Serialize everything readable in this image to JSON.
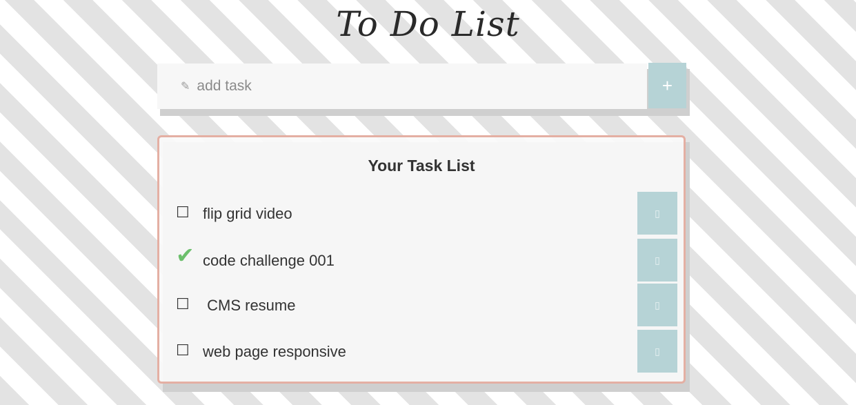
{
  "header": {
    "title": "To Do List"
  },
  "add_form": {
    "icon": "pencil-icon",
    "placeholder": "add task",
    "add_button_label": "+"
  },
  "task_list": {
    "title": "Your Task List",
    "items": [
      {
        "label": "flip grid video",
        "done": false,
        "check_glyph": "☐",
        "delete_glyph": "▯"
      },
      {
        "label": "code challenge 001",
        "done": true,
        "check_glyph": "✔",
        "delete_glyph": "▯"
      },
      {
        "label": " CMS resume",
        "done": false,
        "check_glyph": "☐",
        "delete_glyph": "▯"
      },
      {
        "label": "web page responsive",
        "done": false,
        "check_glyph": "☐",
        "delete_glyph": "▯"
      }
    ]
  },
  "colors": {
    "accent": "#b6d3d6",
    "panel_border": "#e4afa3",
    "done_check": "#6cbf6c"
  }
}
